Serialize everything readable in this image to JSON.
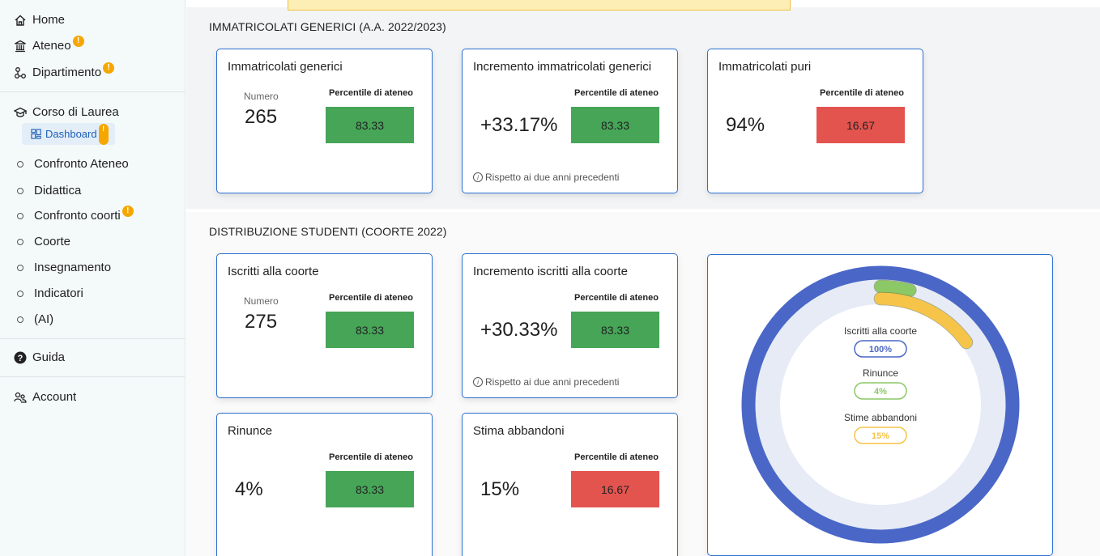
{
  "sidebar": {
    "home": "Home",
    "ateneo": "Ateneo",
    "dipartimento": "Dipartimento",
    "corso": "Corso di Laurea",
    "dashboard": "Dashboard",
    "items": [
      "Confronto Ateneo",
      "Didattica",
      "Confronto coorti",
      "Coorte",
      "Insegnamento",
      "Indicatori",
      "(AI)"
    ],
    "guida": "Guida",
    "account": "Account",
    "warn_glyph": "!"
  },
  "section1": {
    "title": "IMMATRICOLATI GENERICI (A.A. 2022/2023)",
    "cards": [
      {
        "title": "Immatricolati generici",
        "number_label": "Numero",
        "value": "265",
        "pct_label": "Percentile di ateneo",
        "pct": "83.33",
        "status": "green"
      },
      {
        "title": "Incremento immatricolati generici",
        "value": "+33.17%",
        "pct_label": "Percentile di ateneo",
        "pct": "83.33",
        "note": "Rispetto ai due anni precedenti",
        "status": "green"
      },
      {
        "title": "Immatricolati puri",
        "value": "94%",
        "pct_label": "Percentile di ateneo",
        "pct": "16.67",
        "status": "red"
      }
    ]
  },
  "section2": {
    "title": "DISTRIBUZIONE STUDENTI (COORTE 2022)",
    "cards": [
      {
        "title": "Iscritti alla coorte",
        "number_label": "Numero",
        "value": "275",
        "pct_label": "Percentile di ateneo",
        "pct": "83.33",
        "status": "green"
      },
      {
        "title": "Incremento iscritti alla coorte",
        "value": "+30.33%",
        "pct_label": "Percentile di ateneo",
        "pct": "83.33",
        "note": "Rispetto ai due anni precedenti",
        "status": "green"
      },
      {
        "title": "Rinunce",
        "value": "4%",
        "pct_label": "Percentile di ateneo",
        "pct": "83.33",
        "status": "green"
      },
      {
        "title": "Stima abbandoni",
        "value": "15%",
        "pct_label": "Percentile di ateneo",
        "pct": "16.67",
        "status": "red"
      }
    ],
    "donut": {
      "legend": [
        {
          "label": "Iscritti alla coorte",
          "value": "100%",
          "fraction": 1.0,
          "color": "#4a67c7"
        },
        {
          "label": "Rinunce",
          "value": "4%",
          "fraction": 0.04,
          "color": "#8cc866"
        },
        {
          "label": "Stime abbandoni",
          "value": "15%",
          "fraction": 0.15,
          "color": "#f5c449"
        }
      ]
    }
  },
  "colors": {
    "green": "#46a557",
    "red": "#e3544f",
    "accent": "#2d6fcf",
    "warning": "#f5a700"
  }
}
